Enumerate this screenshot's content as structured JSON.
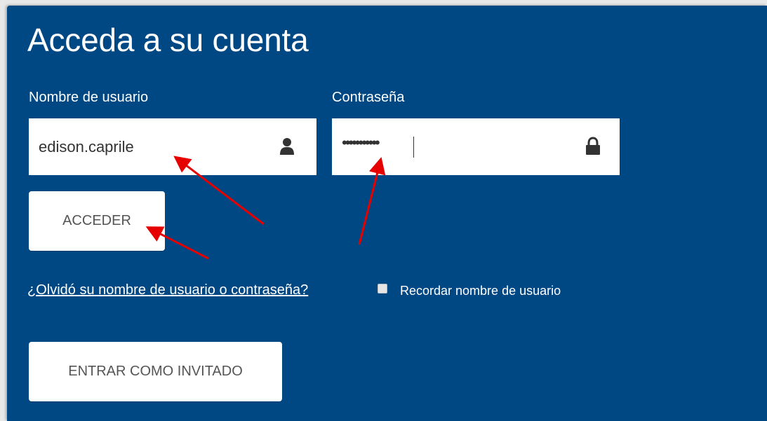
{
  "login": {
    "title": "Acceda a su cuenta",
    "username_label": "Nombre de usuario",
    "username_value": "edison.caprile",
    "password_label": "Contraseña",
    "password_mask": "•••••••••••",
    "login_button": "ACCEDER",
    "forgot_link": "¿Olvidó su nombre de usuario o contraseña?",
    "remember_label": "Recordar nombre de usuario",
    "remember_checked": false,
    "guest_button": "ENTRAR COMO INVITADO"
  },
  "icons": {
    "username_icon": "user-icon",
    "password_icon": "lock-icon"
  },
  "colors": {
    "panel_background": "#004883",
    "annotation_arrow": "#e60000"
  }
}
